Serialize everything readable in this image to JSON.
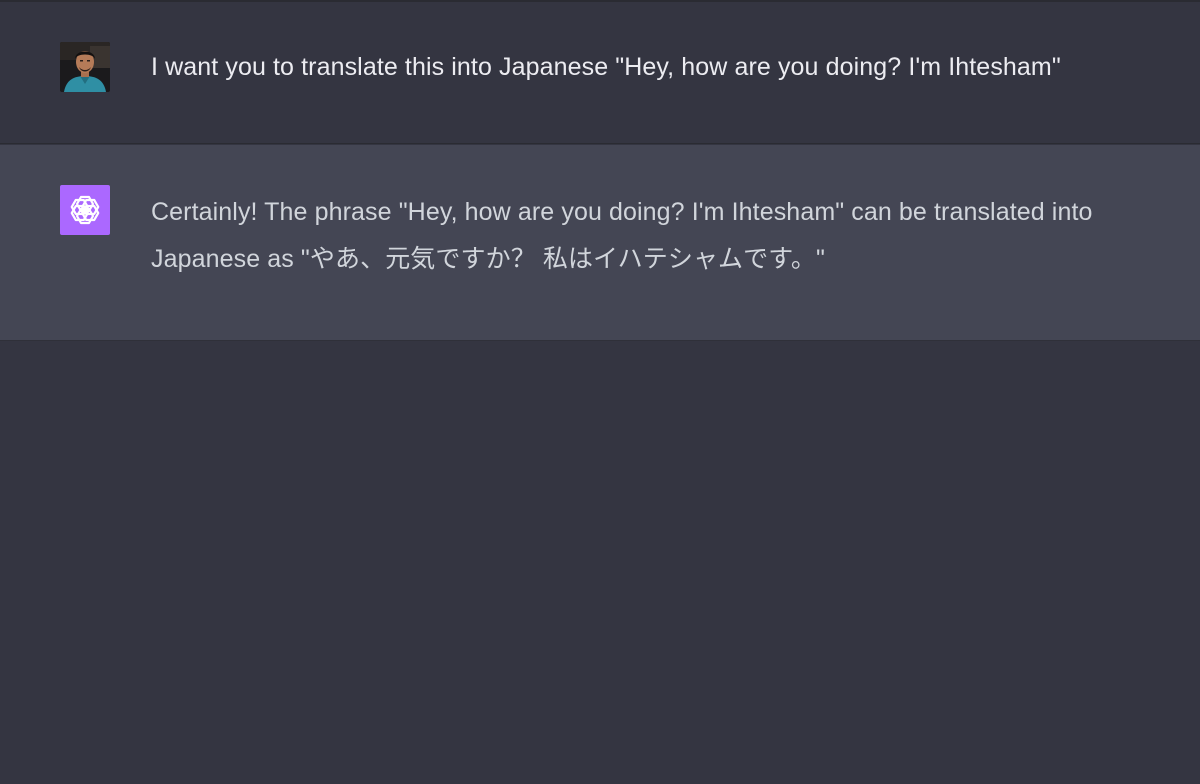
{
  "conversation": {
    "user_message": {
      "text": "I want you to translate this into Japanese \"Hey, how are you doing? I'm Ihtesham\"",
      "avatar_icon": "user-photo-avatar"
    },
    "assistant_message": {
      "text": "Certainly! The phrase \"Hey, how are you doing? I'm Ihtesham\" can be translated into Japanese as \"やあ、元気ですか？ 私はイハテシャムです。\"",
      "avatar_icon": "openai-logo-icon",
      "avatar_color": "#ab68ff"
    }
  },
  "colors": {
    "background": "#343541",
    "assistant_row": "#444654",
    "text": "#ececf1"
  }
}
